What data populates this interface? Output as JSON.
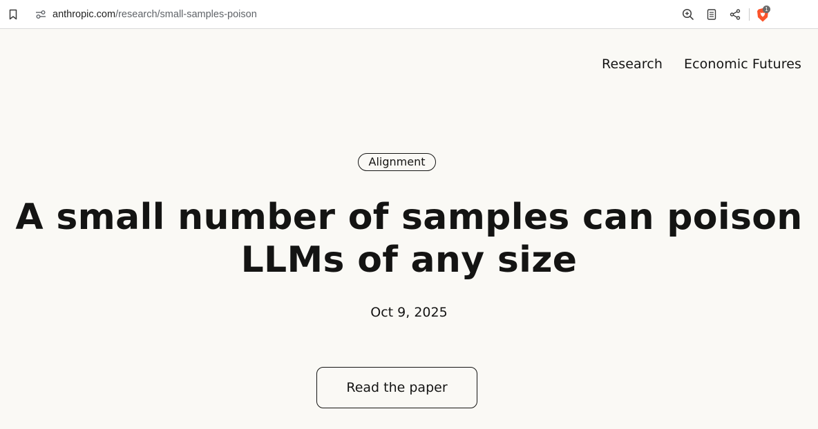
{
  "browser": {
    "url_host": "anthropic.com",
    "url_path": "/research/small-samples-poison",
    "extension_badge_count": "1",
    "icons": {
      "bookmark": "bookmark-icon",
      "site_info": "site-info-icon",
      "zoom": "zoom-in-icon",
      "reader": "reader-mode-icon",
      "share": "share-icon",
      "shields": "brave-shields-icon"
    }
  },
  "nav": {
    "items": [
      {
        "label": "Research"
      },
      {
        "label": "Economic Futures"
      }
    ]
  },
  "article": {
    "category": "Alignment",
    "title_line1": "A small number of samples can poison",
    "title_line2": "LLMs of any size",
    "date": "Oct 9, 2025",
    "cta_label": "Read the paper"
  },
  "colors": {
    "page_background": "#faf9f5",
    "text": "#141413",
    "brave_orange": "#fb542b"
  }
}
